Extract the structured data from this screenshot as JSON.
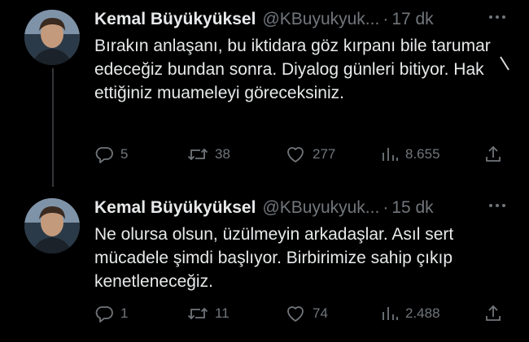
{
  "tweets": [
    {
      "author_name": "Kemal Büyükyüksel",
      "handle": "@KBuyukyuk...",
      "separator": "·",
      "time": "17 dk",
      "text": "Bırakın anlaşanı, bu iktidara göz kırpanı bile tarumar edeceğiz bundan sonra. Diyalog günleri bitiyor. Hak ettiğiniz muameleyi göreceksiniz.",
      "replies": "5",
      "reposts": "38",
      "likes": "277",
      "views": "8.655"
    },
    {
      "author_name": "Kemal Büyükyüksel",
      "handle": "@KBuyukyuk...",
      "separator": "·",
      "time": "15 dk",
      "text": "Ne olursa olsun, üzülmeyin arkadaşlar. Asıl sert mücadele şimdi başlıyor. Birbirimize sahip çıkıp kenetleneceğiz.",
      "replies": "1",
      "reposts": "11",
      "likes": "74",
      "views": "2.488"
    }
  ],
  "icons": {
    "more": "more-horizontal-icon",
    "reply": "reply-icon",
    "repost": "repost-icon",
    "like": "heart-icon",
    "views": "views-chart-icon",
    "share": "share-icon"
  },
  "colors": {
    "background": "#000000",
    "text": "#e7e9ea",
    "muted": "#71767b"
  }
}
